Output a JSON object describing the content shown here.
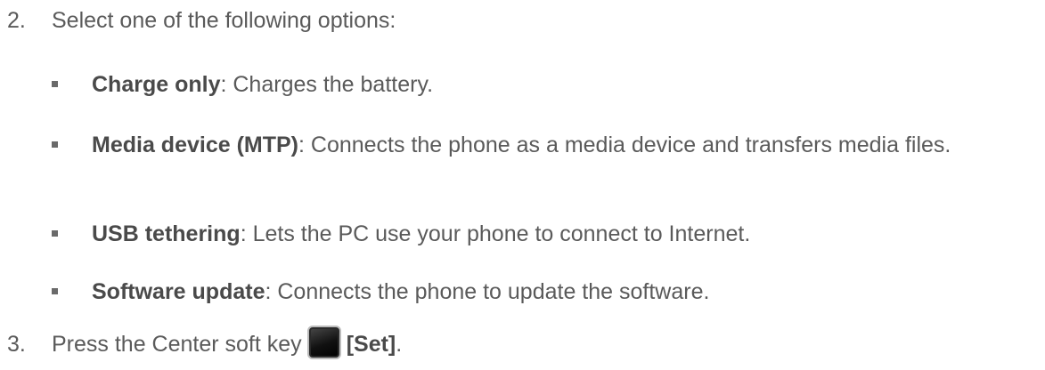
{
  "steps": [
    {
      "number": "2.",
      "text": "Select one of the following options:"
    },
    {
      "number": "3.",
      "text_before": "Press the Center soft key",
      "key_label": "[Set]",
      "text_after": "."
    }
  ],
  "options": [
    {
      "term": "Charge only",
      "desc": ": Charges the battery."
    },
    {
      "term": "Media device (MTP)",
      "desc": ": Connects the phone as a media device and transfers media files."
    },
    {
      "term": "USB tethering",
      "desc": ": Lets the PC use your phone to connect to Internet."
    },
    {
      "term": "Software update",
      "desc": ": Connects the phone to update the software."
    }
  ],
  "icons": {
    "softkey": "center-soft-key-icon"
  }
}
